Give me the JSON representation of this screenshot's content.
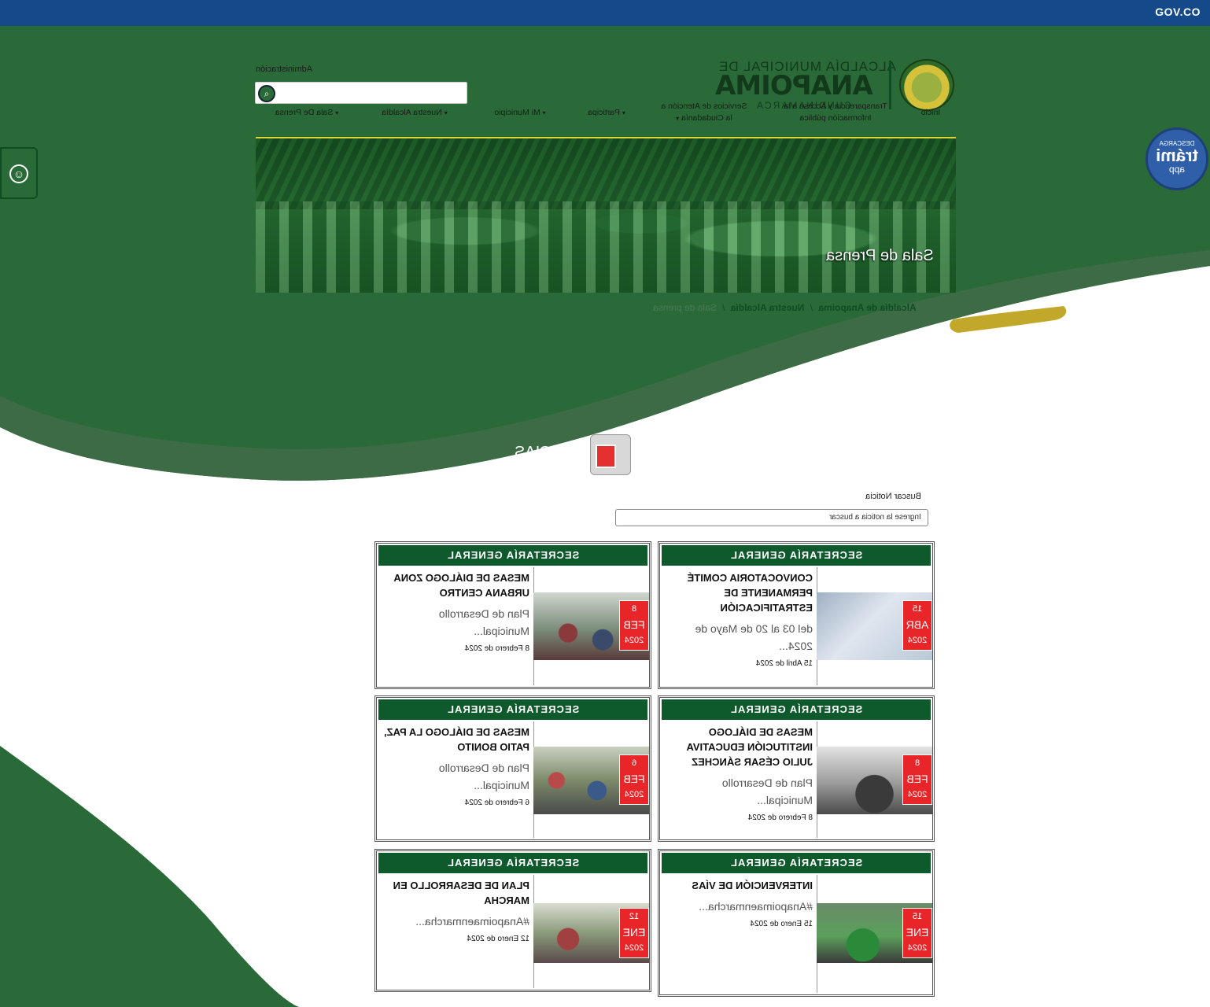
{
  "gov_bar": {
    "logo": "GOV.CO"
  },
  "header": {
    "logo_top": "ALCALDÍA MUNICIPAL DE",
    "logo_main": "ANAPOIMA",
    "logo_sub": "CUNDINAMARCA",
    "admin_link": "Administración",
    "search_placeholder": ""
  },
  "nav": {
    "items": [
      {
        "label": "Inicio"
      },
      {
        "label": "Transparencia y Acceso a la Información pública"
      },
      {
        "label": "Servicios de Atención a la Ciudadanía"
      },
      {
        "label": "Participa"
      },
      {
        "label": "Mi Municipio"
      },
      {
        "label": "Nuestra Alcaldía"
      },
      {
        "label": "Sala De Prensa"
      }
    ]
  },
  "banner": {
    "title": "Sala de Prensa"
  },
  "breadcrumb": {
    "items": [
      "Alcaldía de Anapoima",
      "Nuestra Alcaldía"
    ],
    "current": "Sala de prensa"
  },
  "tramiapp": {
    "top": "DESCARGA",
    "main": "trámi",
    "sub": "app"
  },
  "news": {
    "heading": "NOTICIAS",
    "search_label": "Buscar Noticia",
    "search_placeholder": "Ingrese la noticia a buscar",
    "cards": [
      {
        "category": "SECRETARÍA GENERAL",
        "day": "15",
        "month": "ABR",
        "year": "2024",
        "title": "CONVOCATORIA COMITÉ PERMANENTE DE ESTRATIFICACIÓN",
        "desc": "del 03 al 20 de Mayo de 2024...",
        "date": "15 Abril de 2024"
      },
      {
        "category": "SECRETARÍA GENERAL",
        "day": "8",
        "month": "FEB",
        "year": "2024",
        "title": "MESAS DE DIÁLOGO ZONA URBANA CENTRO",
        "desc": "Plan de Desarrollo Municipal...",
        "date": "8 Febrero de 2024"
      },
      {
        "category": "SECRETARÍA GENERAL",
        "day": "8",
        "month": "FEB",
        "year": "2024",
        "title": "MESAS DE DIÁLOGO INSTITUCIÓN EDUCATIVA JULIO CÉSAR SÁNCHEZ",
        "desc": "Plan de Desarrollo Municipal...",
        "date": "8 Febrero de 2024"
      },
      {
        "category": "SECRETARÍA GENERAL",
        "day": "6",
        "month": "FEB",
        "year": "2024",
        "title": "MESAS DE DIÁLOGO LA PAZ, PATIO BONITO",
        "desc": "Plan de Desarrollo Municipal...",
        "date": "6 Febrero de 2024"
      },
      {
        "category": "SECRETARÍA GENERAL",
        "day": "15",
        "month": "ENE",
        "year": "2024",
        "title": "INTERVENCIÓN DE VÍAS",
        "desc": "#Anapoimaenmarcha...",
        "date": "15 Enero de 2024"
      },
      {
        "category": "SECRETARÍA GENERAL",
        "day": "12",
        "month": "ENE",
        "year": "2024",
        "title": "PLAN DE DESARROLLO EN MARCHA",
        "desc": "#Anapoimaenmarcha...",
        "date": "12 Enero de 2024"
      }
    ]
  },
  "colors": {
    "primary_green": "#2a6a38",
    "dark_green": "#0e4d23",
    "gov_blue": "#154a8a",
    "badge_red": "#e8262a",
    "accent_yellow": "#d9c23a"
  }
}
